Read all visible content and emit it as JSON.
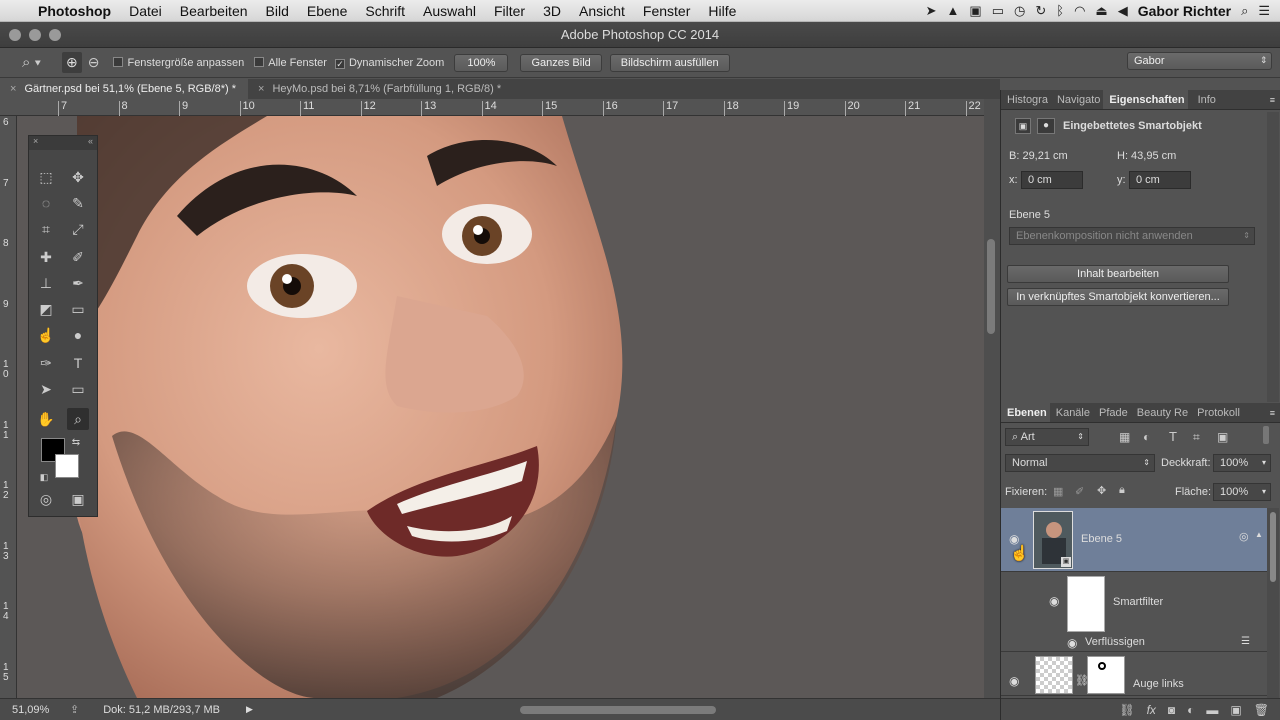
{
  "menubar": {
    "apple": "",
    "app": "Photoshop",
    "items": [
      "Datei",
      "Bearbeiten",
      "Bild",
      "Ebene",
      "Schrift",
      "Auswahl",
      "Filter",
      "3D",
      "Ansicht",
      "Fenster",
      "Hilfe"
    ],
    "user": "Gabor Richter"
  },
  "window": {
    "title": "Adobe Photoshop CC 2014"
  },
  "options": {
    "fit_window": "Fenstergröße anpassen",
    "all_windows": "Alle Fenster",
    "dynamic_zoom": "Dynamischer Zoom",
    "zoom_value": "100%",
    "whole_image": "Ganzes Bild",
    "fill_screen": "Bildschirm ausfüllen",
    "workspace": "Gabor"
  },
  "tabs": [
    {
      "label": "Gärtner.psd bei 51,1% (Ebene 5, RGB/8*) *"
    },
    {
      "label": "HeyMo.psd bei 8,71% (Farbfüllung 1, RGB/8) *"
    }
  ],
  "ruler": {
    "top": [
      "7",
      "8",
      "9",
      "10",
      "11",
      "12",
      "13",
      "14",
      "15",
      "16",
      "17",
      "18",
      "19",
      "20",
      "21",
      "22"
    ],
    "left": [
      "6",
      "7",
      "8",
      "9",
      "1\n0",
      "1\n1",
      "1\n2",
      "1\n3",
      "1\n4",
      "1\n5"
    ]
  },
  "status": {
    "zoom": "51,09%",
    "doc": "Dok: 51,2 MB/293,7 MB"
  },
  "props": {
    "tabs": [
      "Histogra",
      "Navigato",
      "Eigenschaften",
      "Info"
    ],
    "title": "Eingebettetes Smartobjekt",
    "b": "B: 29,21 cm",
    "h": "H: 43,95 cm",
    "x_label": "x:",
    "x_value": "0 cm",
    "y_label": "y:",
    "y_value": "0 cm",
    "layer_name": "Ebene 5",
    "comp": "Ebenenkomposition nicht anwenden",
    "edit_btn": "Inhalt bearbeiten",
    "convert_btn": "In verknüpftes Smartobjekt konvertieren..."
  },
  "layers": {
    "tabs": [
      "Ebenen",
      "Kanäle",
      "Pfade",
      "Beauty Re",
      "Protokoll"
    ],
    "filter": "Art",
    "blend": "Normal",
    "opacity_label": "Deckkraft:",
    "opacity": "100%",
    "lock_label": "Fixieren:",
    "fill_label": "Fläche:",
    "fill": "100%",
    "items": [
      {
        "name": "Ebene 5"
      },
      {
        "name": "Smartfilter"
      },
      {
        "name": "Verflüssigen"
      },
      {
        "name": "Auge links"
      }
    ]
  },
  "colors": {
    "accent": "#6f7f99",
    "selected_layer": "#6f7f99"
  }
}
